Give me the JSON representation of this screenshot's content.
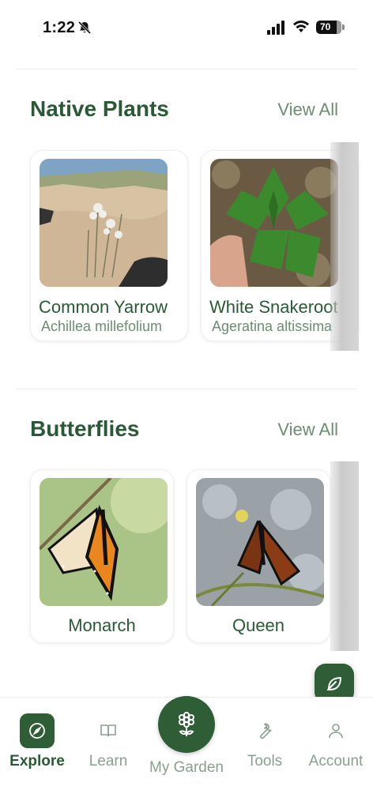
{
  "status_bar": {
    "time": "1:22",
    "battery": "70"
  },
  "sections": [
    {
      "title": "Native Plants",
      "view_all": "View All",
      "items": [
        {
          "name": "Common Yarrow",
          "latin": "Achillea millefolium"
        },
        {
          "name": "White Snakeroot",
          "latin": "Ageratina altissima"
        }
      ]
    },
    {
      "title": "Butterflies",
      "view_all": "View All",
      "items": [
        {
          "name": "Monarch"
        },
        {
          "name": "Queen"
        }
      ]
    }
  ],
  "nav": {
    "explore": "Explore",
    "learn": "Learn",
    "my_garden": "My Garden",
    "tools": "Tools",
    "account": "Account"
  },
  "colors": {
    "primary": "#2f5d36",
    "title": "#2a5a35",
    "muted": "#6c8d72",
    "nav_inactive": "#8aa08e"
  },
  "icons": [
    "bell-slash-icon",
    "cellular-signal-icon",
    "wifi-icon",
    "battery-icon",
    "leaf-icon",
    "compass-icon",
    "book-icon",
    "flower-icon",
    "wrench-icon",
    "user-icon"
  ]
}
